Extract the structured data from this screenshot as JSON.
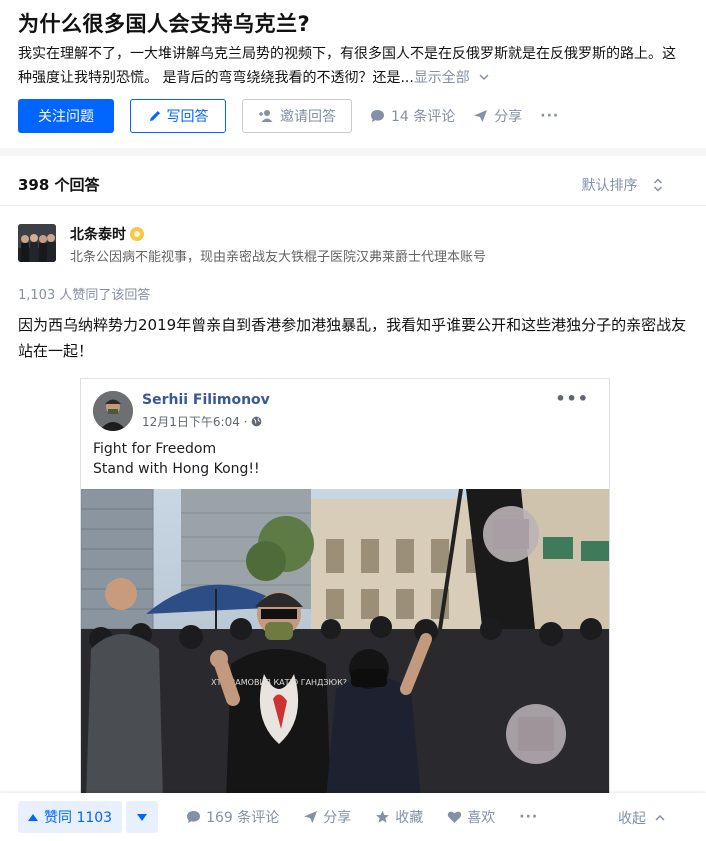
{
  "question": {
    "title": "为什么很多国人会支持乌克兰?",
    "detail": "我实在理解不了，一大堆讲解乌克兰局势的视频下，有很多国人不是在反俄罗斯就是在反俄罗斯的路上。这种强度让我特别恐慌。 是背后的弯弯绕绕我看的不透彻？还是...",
    "show_all": "显示全部",
    "follow_label": "关注问题",
    "write_label": "写回答",
    "invite_label": "邀请回答",
    "comments_label": "14 条评论",
    "share_label": "分享",
    "more_label": "···"
  },
  "answers_header": {
    "count_label": "398 个回答",
    "sort_label": "默认排序"
  },
  "answer": {
    "author_name": "北条泰时",
    "author_bio": "北条公因病不能视事，现由亲密战友大铁棍子医院汉弗莱爵士代理本账号",
    "upvoted_by": "1,103 人赞同了该回答",
    "text": "因为西乌纳粹势力2019年曾亲自到香港参加港独暴乱，我看知乎谁要公开和这些港独分子的亲密战友站在一起！"
  },
  "post": {
    "name": "Serhii Filimonov",
    "time": "12月1日下午6:04 · ",
    "line1": "Fight for Freedom",
    "line2": "Stand with Hong Kong!!",
    "more": "•••",
    "shirt_text": "ХТО ЗАМОВИВ КАТЮ ГАНДЗЮК?"
  },
  "actionbar": {
    "upvote_label": "赞同 1103",
    "comments_label": "169 条评论",
    "share_label": "分享",
    "collect_label": "收藏",
    "like_label": "喜欢",
    "more_label": "···",
    "collapse_label": "收起"
  },
  "colors": {
    "brand_blue": "#0066ff",
    "muted": "#8590a6",
    "fb_name": "#385898"
  }
}
